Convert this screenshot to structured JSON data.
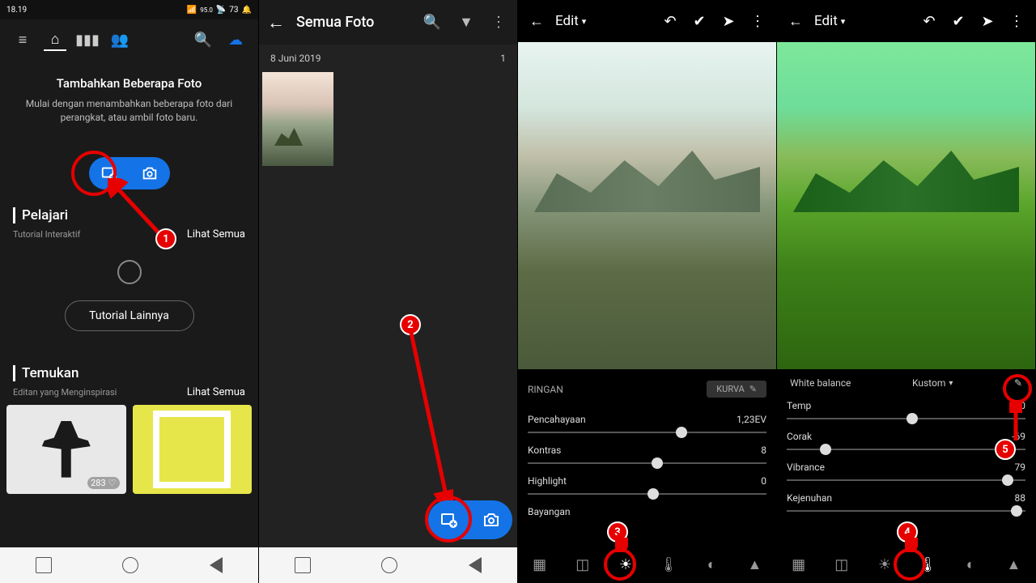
{
  "panel1": {
    "statusbar": {
      "time": "18.19",
      "net": "95.0",
      "battery": "73"
    },
    "empty": {
      "title": "Tambahkan Beberapa Foto",
      "desc": "Mulai dengan menambahkan beberapa foto dari perangkat, atau ambil foto baru."
    },
    "learn": {
      "title": "Pelajari",
      "sub": "Tutorial Interaktif",
      "link": "Lihat Semua",
      "more": "Tutorial Lainnya"
    },
    "discover": {
      "title": "Temukan",
      "sub": "Editan yang Menginspirasi",
      "link": "Lihat Semua",
      "likes": "283"
    }
  },
  "panel2": {
    "title": "Semua Foto",
    "date": "8 Juni 2019",
    "count": "1"
  },
  "panel3": {
    "title": "Edit",
    "mode": "RINGAN",
    "kurva": "KURVA",
    "sliders": {
      "pencahayaan": {
        "label": "Pencahayaan",
        "value": "1,23EV"
      },
      "kontras": {
        "label": "Kontras",
        "value": "8"
      },
      "highlight": {
        "label": "Highlight",
        "value": "0"
      },
      "bayangan": {
        "label": "Bayangan"
      }
    }
  },
  "panel4": {
    "title": "Edit",
    "wb": {
      "label": "White balance",
      "preset": "Kustom"
    },
    "sliders": {
      "temp": {
        "label": "Temp",
        "value": "0"
      },
      "corak": {
        "label": "Corak",
        "value": "-69"
      },
      "vibrance": {
        "label": "Vibrance",
        "value": "79"
      },
      "kejenuhan": {
        "label": "Kejenuhan",
        "value": "88"
      }
    }
  },
  "badges": {
    "b1": "1",
    "b2": "2",
    "b3": "3",
    "b4": "4",
    "b5": "5"
  }
}
